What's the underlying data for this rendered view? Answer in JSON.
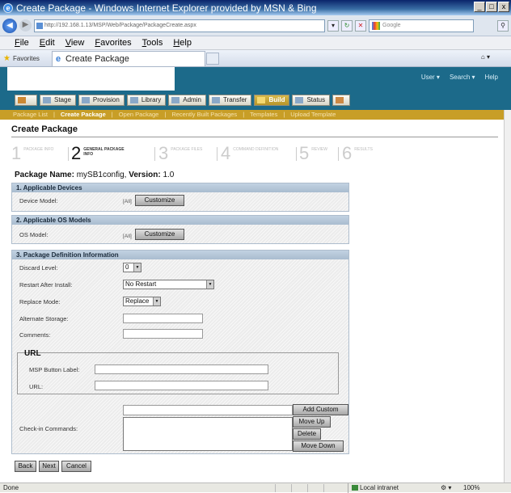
{
  "window": {
    "title": "Create Package - Windows Internet Explorer provided by MSN & Bing",
    "controls": [
      "_",
      "□",
      "x"
    ]
  },
  "address_bar": {
    "url": "http://192.168.1.13/MSP/Web/Package/PackageCreate.aspx",
    "search_placeholder": "Google"
  },
  "menu": [
    "File",
    "Edit",
    "View",
    "Favorites",
    "Tools",
    "Help"
  ],
  "favorites_bar": {
    "favorites_label": "Favorites",
    "tab_title": "Create Package"
  },
  "top_nav": [
    "User ▾",
    "Search ▾",
    "Help"
  ],
  "tabs": [
    {
      "label": "Stage",
      "selected": false
    },
    {
      "label": "Provision",
      "selected": false
    },
    {
      "label": "Library",
      "selected": false
    },
    {
      "label": "Admin",
      "selected": false
    },
    {
      "label": "Transfer",
      "selected": false
    },
    {
      "label": "Build",
      "selected": true
    },
    {
      "label": "Status",
      "selected": false
    }
  ],
  "subnav": [
    "Package List",
    "Create Package",
    "Open Package",
    "Recently Built Packages",
    "Templates",
    "Upload Template"
  ],
  "page_title": "Create Package",
  "steps": [
    {
      "num": "1",
      "label": "PACKAGE INFO"
    },
    {
      "num": "2",
      "label": "GENERAL PACKAGE INFO"
    },
    {
      "num": "3",
      "label": "PACKAGE FILES"
    },
    {
      "num": "4",
      "label": "COMMAND DEFINITION"
    },
    {
      "num": "5",
      "label": "REVIEW"
    },
    {
      "num": "6",
      "label": "RESULTS"
    }
  ],
  "package": {
    "name_label": "Package Name:",
    "name": "mySB1config,",
    "version_label": "Version:",
    "version": "1.0"
  },
  "section1": {
    "title": "1. Applicable Devices",
    "field_label": "Device Model:",
    "all": "[All]",
    "button": "Customize"
  },
  "section2": {
    "title": "2. Applicable OS Models",
    "field_label": "OS Model:",
    "all": "[All]",
    "button": "Customize"
  },
  "section3": {
    "title": "3. Package Definition Information",
    "discard_label": "Discard Level:",
    "discard_value": "0",
    "restart_label": "Restart After Install:",
    "restart_value": "No Restart",
    "replace_label": "Replace Mode:",
    "replace_value": "Replace",
    "alt_storage_label": "Alternate Storage:",
    "comments_label": "Comments:",
    "url_legend": "URL",
    "msp_button_label": "MSP Button Label:",
    "url_label": "URL:",
    "checkin_label": "Check-in Commands:",
    "add_custom": "Add Custom",
    "move_up": "Move Up",
    "delete": "Delete",
    "move_down": "Move Down"
  },
  "footer_buttons": {
    "back": "Back",
    "next": "Next",
    "cancel": "Cancel"
  },
  "status_bar": {
    "status": "Done",
    "zone": "Local intranet",
    "zoom": "100%"
  }
}
